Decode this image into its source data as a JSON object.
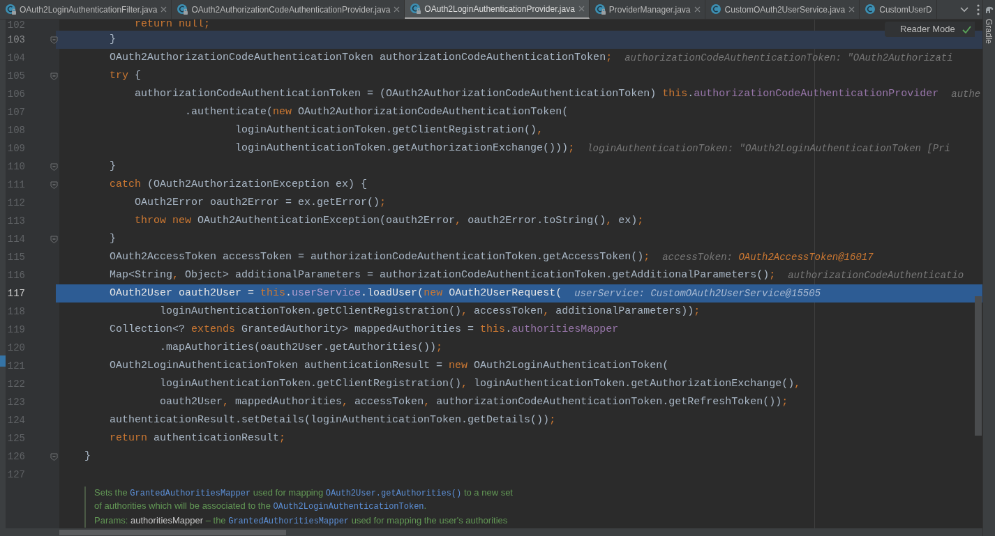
{
  "tabs": [
    {
      "label": "OAuth2LoginAuthenticationFilter.java",
      "selected": false,
      "locked": true,
      "closable": true
    },
    {
      "label": "OAuth2AuthorizationCodeAuthenticationProvider.java",
      "selected": false,
      "locked": true,
      "closable": true
    },
    {
      "label": "OAuth2LoginAuthenticationProvider.java",
      "selected": true,
      "locked": true,
      "closable": true
    },
    {
      "label": "ProviderManager.java",
      "selected": false,
      "locked": true,
      "closable": true
    },
    {
      "label": "CustomOAuth2UserService.java",
      "selected": false,
      "locked": false,
      "closable": true
    },
    {
      "label": "CustomUserD",
      "selected": false,
      "locked": false,
      "closable": false
    }
  ],
  "reader_mode": {
    "label": "Reader Mode"
  },
  "side_tool": {
    "label": "Gradle"
  },
  "lines": [
    {
      "number": "102",
      "kind": "normal",
      "fold": false,
      "tokens": [
        {
          "kind": "keyword",
          "text": "            return null;"
        }
      ]
    },
    {
      "number": "103",
      "kind": "caret_line",
      "fold": true,
      "tokens": [
        {
          "kind": "plain",
          "text": "        }"
        }
      ]
    },
    {
      "number": "104",
      "kind": "normal",
      "fold": false,
      "tokens": [
        {
          "kind": "plain",
          "text": "        OAuth2AuthorizationCodeAuthenticationToken authorizationCodeAuthenticationToken"
        },
        {
          "kind": "keyword",
          "text": ";"
        }
      ],
      "hint": [
        {
          "kind": "hint",
          "text": "authorizationCodeAuthenticationToken: \"OAuth2Authorizati"
        }
      ]
    },
    {
      "number": "105",
      "kind": "normal",
      "fold": true,
      "tokens": [
        {
          "kind": "keyword",
          "text": "        try"
        },
        {
          "kind": "plain",
          "text": " {"
        }
      ]
    },
    {
      "number": "106",
      "kind": "normal",
      "fold": false,
      "tokens": [
        {
          "kind": "plain",
          "text": "            authorizationCodeAuthenticationToken = (OAuth2AuthorizationCodeAuthenticationToken) "
        },
        {
          "kind": "keyword",
          "text": "this"
        },
        {
          "kind": "plain",
          "text": "."
        },
        {
          "kind": "field",
          "text": "authorizationCodeAuthenticationProvider"
        }
      ],
      "hint": [
        {
          "kind": "hint",
          "text": "authe"
        }
      ]
    },
    {
      "number": "107",
      "kind": "normal",
      "fold": false,
      "tokens": [
        {
          "kind": "plain",
          "text": "                    .authenticate("
        },
        {
          "kind": "keyword",
          "text": "new "
        },
        {
          "kind": "plain",
          "text": "OAuth2AuthorizationCodeAuthenticationToken("
        }
      ]
    },
    {
      "number": "108",
      "kind": "normal",
      "fold": false,
      "tokens": [
        {
          "kind": "plain",
          "text": "                            loginAuthenticationToken.getClientRegistration()"
        },
        {
          "kind": "keyword",
          "text": ","
        }
      ]
    },
    {
      "number": "109",
      "kind": "normal",
      "fold": false,
      "tokens": [
        {
          "kind": "plain",
          "text": "                            loginAuthenticationToken.getAuthorizationExchange()))"
        },
        {
          "kind": "keyword",
          "text": ";"
        }
      ],
      "hint": [
        {
          "kind": "hint",
          "text": "loginAuthenticationToken: \"OAuth2LoginAuthenticationToken [Pri"
        }
      ]
    },
    {
      "number": "110",
      "kind": "normal",
      "fold": true,
      "tokens": [
        {
          "kind": "plain",
          "text": "        }"
        }
      ]
    },
    {
      "number": "111",
      "kind": "normal",
      "fold": true,
      "tokens": [
        {
          "kind": "keyword",
          "text": "        catch"
        },
        {
          "kind": "plain",
          "text": " (OAuth2AuthorizationException ex) {"
        }
      ]
    },
    {
      "number": "112",
      "kind": "normal",
      "fold": false,
      "tokens": [
        {
          "kind": "plain",
          "text": "            OAuth2Error oauth2Error = ex.getError()"
        },
        {
          "kind": "keyword",
          "text": ";"
        }
      ]
    },
    {
      "number": "113",
      "kind": "normal",
      "fold": false,
      "tokens": [
        {
          "kind": "keyword",
          "text": "            throw new "
        },
        {
          "kind": "plain",
          "text": "OAuth2AuthenticationException(oauth2Error"
        },
        {
          "kind": "keyword",
          "text": ","
        },
        {
          "kind": "plain",
          "text": " oauth2Error.toString()"
        },
        {
          "kind": "keyword",
          "text": ","
        },
        {
          "kind": "plain",
          "text": " ex)"
        },
        {
          "kind": "keyword",
          "text": ";"
        }
      ]
    },
    {
      "number": "114",
      "kind": "normal",
      "fold": true,
      "tokens": [
        {
          "kind": "plain",
          "text": "        }"
        }
      ]
    },
    {
      "number": "115",
      "kind": "normal",
      "fold": false,
      "tokens": [
        {
          "kind": "plain",
          "text": "        OAuth2AccessToken accessToken = authorizationCodeAuthenticationToken.getAccessToken()"
        },
        {
          "kind": "keyword",
          "text": ";"
        }
      ],
      "hint": [
        {
          "kind": "hint",
          "text": "accessToken: "
        },
        {
          "kind": "value",
          "text": "OAuth2AccessToken@16017"
        }
      ]
    },
    {
      "number": "116",
      "kind": "normal",
      "fold": false,
      "tokens": [
        {
          "kind": "plain",
          "text": "        Map<String"
        },
        {
          "kind": "keyword",
          "text": ","
        },
        {
          "kind": "plain",
          "text": " Object> additionalParameters = authorizationCodeAuthenticationToken.getAdditionalParameters()"
        },
        {
          "kind": "keyword",
          "text": ";"
        }
      ],
      "hint": [
        {
          "kind": "hint",
          "text": "authorizationCodeAuthenticatio"
        }
      ]
    },
    {
      "number": "117",
      "kind": "execution_point",
      "fold": false,
      "tokens": [
        {
          "kind": "plain",
          "text": "        OAuth2User oauth2User = "
        },
        {
          "kind": "keyword",
          "text": "this"
        },
        {
          "kind": "plain",
          "text": "."
        },
        {
          "kind": "field",
          "text": "userService"
        },
        {
          "kind": "plain",
          "text": ".loadUser("
        },
        {
          "kind": "keyword",
          "text": "new "
        },
        {
          "kind": "plain",
          "text": "OAuth2UserRequest("
        }
      ],
      "hint": [
        {
          "kind": "hint",
          "text": "userService: CustomOAuth2UserService@15505"
        }
      ]
    },
    {
      "number": "118",
      "kind": "normal",
      "fold": false,
      "tokens": [
        {
          "kind": "plain",
          "text": "                loginAuthenticationToken.getClientRegistration()"
        },
        {
          "kind": "keyword",
          "text": ","
        },
        {
          "kind": "plain",
          "text": " accessToken"
        },
        {
          "kind": "keyword",
          "text": ","
        },
        {
          "kind": "plain",
          "text": " additionalParameters))"
        },
        {
          "kind": "keyword",
          "text": ";"
        }
      ]
    },
    {
      "number": "119",
      "kind": "normal",
      "fold": false,
      "tokens": [
        {
          "kind": "plain",
          "text": "        Collection<? "
        },
        {
          "kind": "keyword",
          "text": "extends "
        },
        {
          "kind": "plain",
          "text": "GrantedAuthority> mappedAuthorities = "
        },
        {
          "kind": "keyword",
          "text": "this"
        },
        {
          "kind": "plain",
          "text": "."
        },
        {
          "kind": "field",
          "text": "authoritiesMapper"
        }
      ]
    },
    {
      "number": "120",
      "kind": "normal",
      "fold": false,
      "tokens": [
        {
          "kind": "plain",
          "text": "                .mapAuthorities(oauth2User.getAuthorities())"
        },
        {
          "kind": "keyword",
          "text": ";"
        }
      ]
    },
    {
      "number": "121",
      "kind": "normal",
      "fold": false,
      "tokens": [
        {
          "kind": "plain",
          "text": "        OAuth2LoginAuthenticationToken authenticationResult = "
        },
        {
          "kind": "keyword",
          "text": "new "
        },
        {
          "kind": "plain",
          "text": "OAuth2LoginAuthenticationToken("
        }
      ]
    },
    {
      "number": "122",
      "kind": "normal",
      "fold": false,
      "tokens": [
        {
          "kind": "plain",
          "text": "                loginAuthenticationToken.getClientRegistration()"
        },
        {
          "kind": "keyword",
          "text": ","
        },
        {
          "kind": "plain",
          "text": " loginAuthenticationToken.getAuthorizationExchange()"
        },
        {
          "kind": "keyword",
          "text": ","
        }
      ]
    },
    {
      "number": "123",
      "kind": "normal",
      "fold": false,
      "tokens": [
        {
          "kind": "plain",
          "text": "                oauth2User"
        },
        {
          "kind": "keyword",
          "text": ","
        },
        {
          "kind": "plain",
          "text": " mappedAuthorities"
        },
        {
          "kind": "keyword",
          "text": ","
        },
        {
          "kind": "plain",
          "text": " accessToken"
        },
        {
          "kind": "keyword",
          "text": ","
        },
        {
          "kind": "plain",
          "text": " authorizationCodeAuthenticationToken.getRefreshToken())"
        },
        {
          "kind": "keyword",
          "text": ";"
        }
      ]
    },
    {
      "number": "124",
      "kind": "normal",
      "fold": false,
      "tokens": [
        {
          "kind": "plain",
          "text": "        authenticationResult.setDetails(loginAuthenticationToken.getDetails())"
        },
        {
          "kind": "keyword",
          "text": ";"
        }
      ]
    },
    {
      "number": "125",
      "kind": "normal",
      "fold": false,
      "tokens": [
        {
          "kind": "keyword",
          "text": "        return "
        },
        {
          "kind": "plain",
          "text": "authenticationResult"
        },
        {
          "kind": "keyword",
          "text": ";"
        }
      ]
    },
    {
      "number": "126",
      "kind": "normal",
      "fold": true,
      "tokens": [
        {
          "kind": "plain",
          "text": "    }"
        }
      ]
    },
    {
      "number": "127",
      "kind": "normal",
      "fold": false
    }
  ],
  "doc": [
    [
      {
        "kind": "text",
        "text": "Sets the "
      },
      {
        "kind": "code",
        "text": "GrantedAuthoritiesMapper"
      },
      {
        "kind": "text",
        "text": " used for mapping "
      },
      {
        "kind": "code",
        "text": "OAuth2User.getAuthorities()"
      },
      {
        "kind": "text",
        "text": " to a new set"
      }
    ],
    [
      {
        "kind": "text",
        "text": "of authorities which will be associated to the "
      },
      {
        "kind": "code",
        "text": "OAuth2LoginAuthenticationToken"
      },
      {
        "kind": "text",
        "text": "."
      }
    ],
    [
      {
        "kind": "text",
        "text": "Params: "
      },
      {
        "kind": "param",
        "text": "authoritiesMapper"
      },
      {
        "kind": "text",
        "text": " – the "
      },
      {
        "kind": "code",
        "text": "GrantedAuthoritiesMapper"
      },
      {
        "kind": "text",
        "text": " used for mapping the user's authorities"
      }
    ]
  ]
}
